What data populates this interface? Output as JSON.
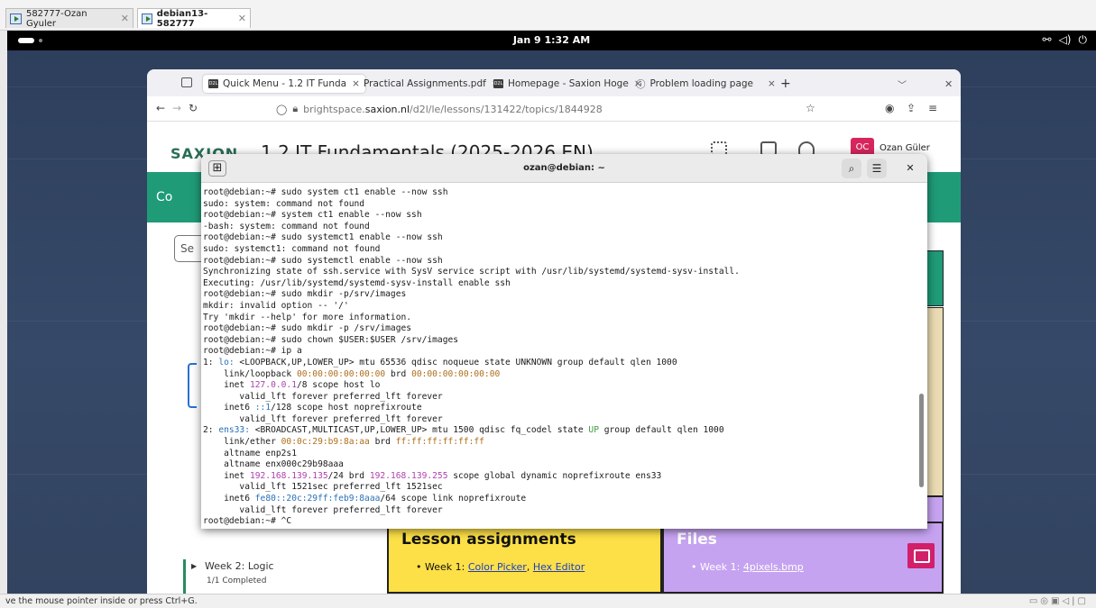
{
  "host": {
    "tabs": [
      {
        "label": "582777-Ozan Gyuler",
        "close": "✕"
      },
      {
        "label": "debian13-582777",
        "close": "✕"
      }
    ],
    "status_text": "ve the mouse pointer inside or press Ctrl+G."
  },
  "gnome": {
    "clock": "Jan 9  1:32 AM",
    "tray_network": "⚯",
    "tray_volume": "◁)",
    "tray_power": "⏻"
  },
  "firefox": {
    "tabs": [
      {
        "label": "Quick Menu - 1.2 IT Funda",
        "close": "×"
      },
      {
        "label": "Practical Assignments.pdf",
        "close": "×"
      },
      {
        "label": "Homepage - Saxion Hoge",
        "close": "×"
      },
      {
        "label": "Problem loading page",
        "close": "×"
      }
    ],
    "new_tab": "+",
    "url_prefix": "brightspace.",
    "url_domain": "saxion.nl",
    "url_path": "/d2l/le/lessons/131422/topics/1844928"
  },
  "page": {
    "brand": "SAXION",
    "course_title": "1.2 IT Fundamentals (2025-2026 EN)",
    "band_label": "Co",
    "search_placeholder": "Se",
    "avatar_initials": "OC",
    "user_name": "Ozan Güler",
    "week2_label": "Week 2: Logic",
    "week2_progress": "1/1 Completed",
    "lesson_assignments_title": "Lesson assignments",
    "lesson_item_prefix": "Week 1:",
    "lesson_link1": "Color Picker",
    "lesson_link2": "Hex Editor",
    "files_title": "Files",
    "files_item_prefix": "Week 1:",
    "files_link": "4pixels.bmp"
  },
  "terminal": {
    "title": "ozan@debian: ~",
    "lines": [
      [
        {
          "t": "root@debian:~# sudo system ct1 enable --now ssh"
        }
      ],
      [
        {
          "t": "sudo: system: command not found"
        }
      ],
      [
        {
          "t": "root@debian:~# system ct1 enable --now ssh"
        }
      ],
      [
        {
          "t": "-bash: system: command not found"
        }
      ],
      [
        {
          "t": "root@debian:~# sudo systemct1 enable --now ssh"
        }
      ],
      [
        {
          "t": "sudo: systemct1: command not found"
        }
      ],
      [
        {
          "t": "root@debian:~# sudo systemctl enable --now ssh"
        }
      ],
      [
        {
          "t": "Synchronizing state of ssh.service with SysV service script with /usr/lib/systemd/systemd-sysv-install."
        }
      ],
      [
        {
          "t": "Executing: /usr/lib/systemd/systemd-sysv-install enable ssh"
        }
      ],
      [
        {
          "t": "root@debian:~# sudo mkdir -p/srv/images"
        }
      ],
      [
        {
          "t": "mkdir: invalid option -- '/'"
        }
      ],
      [
        {
          "t": "Try 'mkdir --help' for more information."
        }
      ],
      [
        {
          "t": "root@debian:~# sudo mkdir -p /srv/images"
        }
      ],
      [
        {
          "t": "root@debian:~# sudo chown $USER:$USER /srv/images"
        }
      ],
      [
        {
          "t": "root@debian:~# ip a"
        }
      ],
      [
        {
          "t": "1: "
        },
        {
          "t": "lo:",
          "c": "blue"
        },
        {
          "t": " <LOOPBACK,UP,LOWER_UP> mtu 65536 qdisc noqueue state UNKNOWN group default qlen 1000"
        }
      ],
      [
        {
          "t": "    link/loopback "
        },
        {
          "t": "00:00:00:00:00:00",
          "c": "amber"
        },
        {
          "t": " brd "
        },
        {
          "t": "00:00:00:00:00:00",
          "c": "amber"
        }
      ],
      [
        {
          "t": "    inet "
        },
        {
          "t": "127.0.0.1",
          "c": "mag"
        },
        {
          "t": "/8 scope host lo"
        }
      ],
      [
        {
          "t": "       valid_lft forever preferred_lft forever"
        }
      ],
      [
        {
          "t": "    inet6 "
        },
        {
          "t": "::1",
          "c": "blue"
        },
        {
          "t": "/128 scope host noprefixroute"
        }
      ],
      [
        {
          "t": "       valid_lft forever preferred_lft forever"
        }
      ],
      [
        {
          "t": "2: "
        },
        {
          "t": "ens33:",
          "c": "blue"
        },
        {
          "t": " <BROADCAST,MULTICAST,UP,LOWER_UP> mtu 1500 qdisc fq_codel state "
        },
        {
          "t": "UP",
          "c": "green"
        },
        {
          "t": " group default qlen 1000"
        }
      ],
      [
        {
          "t": "    link/ether "
        },
        {
          "t": "00:0c:29:b9:8a:aa",
          "c": "amber"
        },
        {
          "t": " brd "
        },
        {
          "t": "ff:ff:ff:ff:ff:ff",
          "c": "amber"
        }
      ],
      [
        {
          "t": "    altname enp2s1"
        }
      ],
      [
        {
          "t": "    altname enx000c29b98aaa"
        }
      ],
      [
        {
          "t": "    inet "
        },
        {
          "t": "192.168.139.135",
          "c": "mag"
        },
        {
          "t": "/24 brd "
        },
        {
          "t": "192.168.139.255",
          "c": "mag"
        },
        {
          "t": " scope global dynamic noprefixroute ens33"
        }
      ],
      [
        {
          "t": "       valid_lft 1521sec preferred_lft 1521sec"
        }
      ],
      [
        {
          "t": "    inet6 "
        },
        {
          "t": "fe80::20c:29ff:feb9:8aaa",
          "c": "blue"
        },
        {
          "t": "/64 scope link noprefixroute"
        }
      ],
      [
        {
          "t": "       valid_lft forever preferred_lft forever"
        }
      ],
      [
        {
          "t": "root@debian:~# ^C"
        }
      ]
    ]
  },
  "colors": {
    "accent_green": "#1f9b78",
    "terminal_iface": "#2a70b8",
    "terminal_ip": "#b03fb0",
    "terminal_mac": "#b06e1c",
    "terminal_state": "#3d9a40"
  }
}
